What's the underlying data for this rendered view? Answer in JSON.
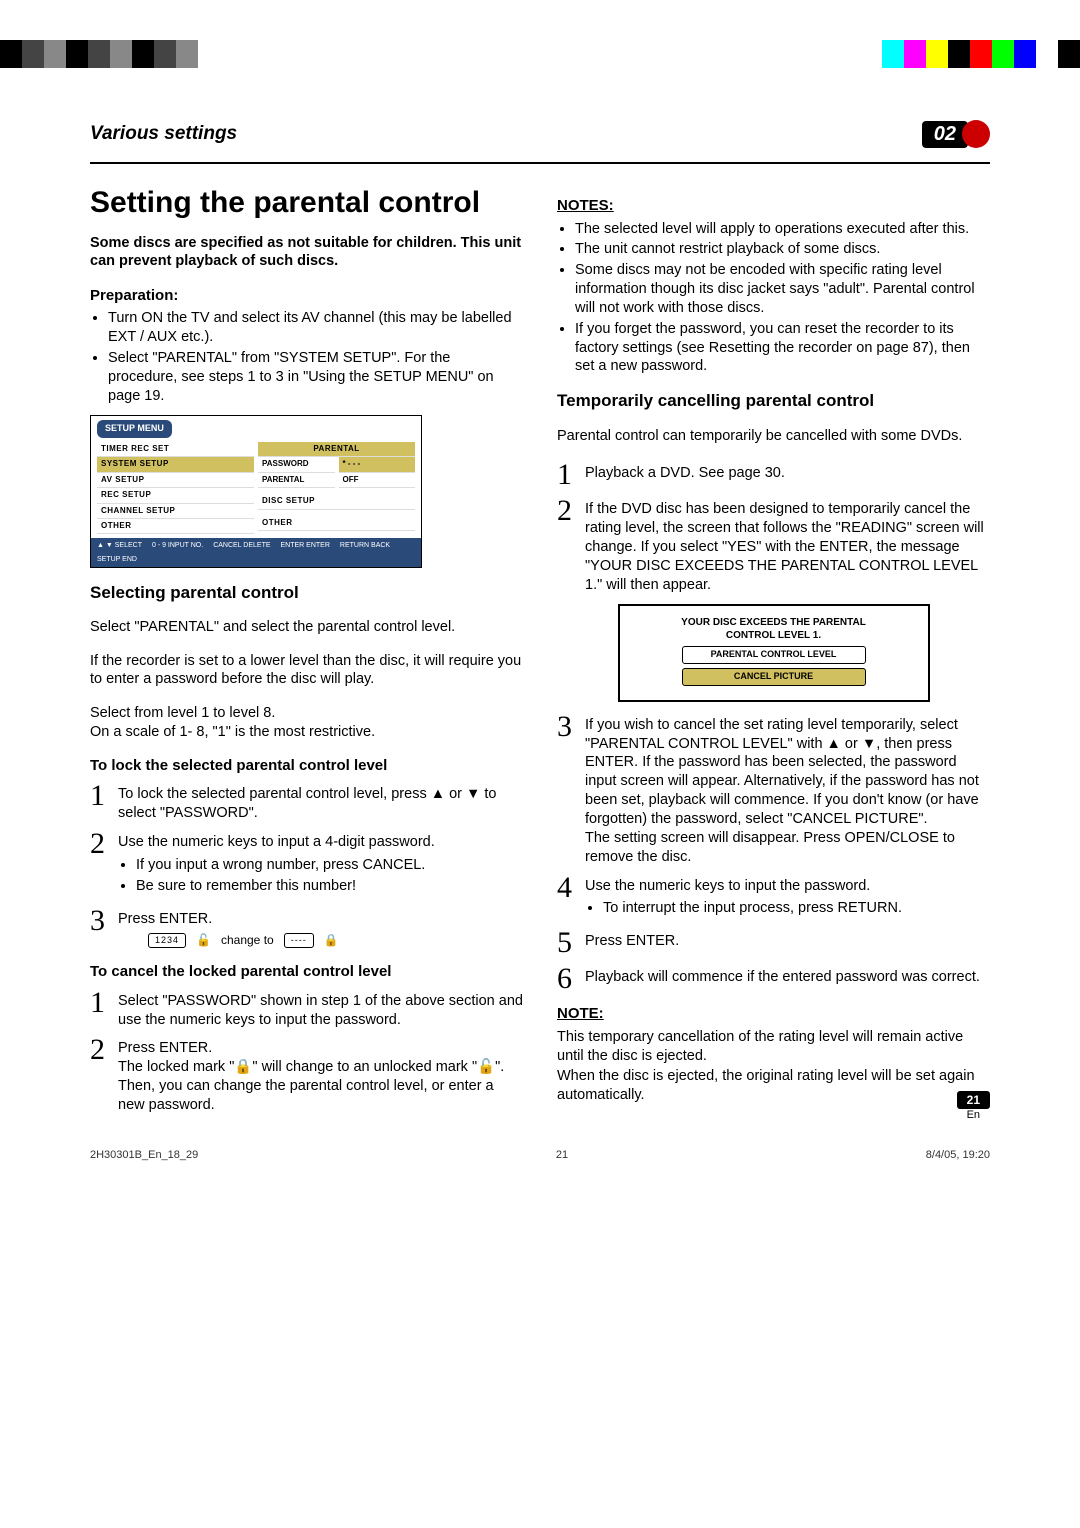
{
  "header": {
    "title": "Various settings",
    "chapter": "02"
  },
  "main_title": "Setting the parental control",
  "intro": "Some discs are specified as not suitable for children. This unit can prevent playback of such discs.",
  "preparation": {
    "heading": "Preparation:",
    "items": [
      "Turn ON the TV and select its AV channel (this may be labelled EXT / AUX etc.).",
      "Select \"PARENTAL\" from \"SYSTEM SETUP\". For the procedure, see steps 1 to 3 in \"Using the SETUP MENU\" on page 19."
    ]
  },
  "setup_menu": {
    "title": "SETUP MENU",
    "left": [
      "TIMER REC SET",
      "SYSTEM SETUP",
      "AV SETUP",
      "REC SETUP",
      "CHANNEL SETUP",
      "OTHER"
    ],
    "right_top_hl": "PARENTAL",
    "right_rows": [
      {
        "l": "PASSWORD",
        "r": "* - - -"
      },
      {
        "l": "PARENTAL",
        "r": "OFF"
      }
    ],
    "right_groups": [
      "DISC SETUP",
      "OTHER"
    ],
    "bottom": [
      "▲ ▼  SELECT",
      "0 - 9  INPUT NO.",
      "CANCEL  DELETE",
      "ENTER  ENTER",
      "RETURN  BACK",
      "SETUP  END"
    ]
  },
  "selecting": {
    "heading": "Selecting parental control",
    "p1": "Select \"PARENTAL\" and select the parental control level.",
    "p2": "If the recorder is set to a lower level than the disc, it will require you to enter a password before the disc will play.",
    "p3": "Select from level 1 to level 8.",
    "p4": "On a scale of 1- 8, \"1\" is the most restrictive.",
    "lock": {
      "heading": "To lock the selected parental control level",
      "s1": "To lock the selected parental control level, press ▲ or ▼ to select \"PASSWORD\".",
      "s2": "Use the numeric keys to input a 4-digit password.",
      "s2b1": "If you input a wrong number, press CANCEL.",
      "s2b2": "Be sure to remember this number!",
      "s3": "Press ENTER.",
      "diag_a": "1234",
      "diag_txt": "change to",
      "diag_b": "----"
    },
    "cancel": {
      "heading": "To cancel the locked parental control level",
      "s1": "Select \"PASSWORD\" shown in step 1 of the above section and use the numeric keys to input the password.",
      "s2a": "Press ENTER.",
      "s2b": "The locked mark \"🔒\" will change to an unlocked mark \"🔓\".",
      "s2c": "Then, you can change the parental control level, or enter a new password."
    }
  },
  "notes": {
    "heading": "NOTES:",
    "items": [
      "The selected level will apply to operations executed after this.",
      "The unit cannot restrict playback of some discs.",
      "Some discs may not be encoded with specific rating level information though its disc jacket says \"adult\". Parental control will not work with those discs.",
      "If you forget the password, you can reset the recorder to its factory settings (see Resetting the recorder on page 87), then set a new password."
    ]
  },
  "temp": {
    "heading": "Temporarily cancelling parental control",
    "intro": "Parental control can temporarily be cancelled with some DVDs.",
    "s1": "Playback a DVD. See page 30.",
    "s2": "If the DVD disc has been designed to temporarily cancel the rating level, the screen that follows the \"READING\" screen will change. If you select \"YES\" with the ENTER, the message \"YOUR DISC EXCEEDS THE PARENTAL CONTROL LEVEL 1.\" will then appear.",
    "dialog": {
      "line1": "YOUR DISC EXCEEDS THE PARENTAL",
      "line2": "CONTROL LEVEL 1.",
      "opt1": "PARENTAL CONTROL LEVEL",
      "opt2": "CANCEL PICTURE"
    },
    "s3a": "If you wish to cancel the set rating level temporarily, select \"PARENTAL CONTROL LEVEL\" with ▲ or ▼, then press ENTER. If the password has been selected, the password input screen will appear. Alternatively, if the password has not been set, playback will commence. If you don't know (or have forgotten) the password, select \"CANCEL PICTURE\".",
    "s3b": "The setting screen will disappear. Press OPEN/CLOSE to remove the disc.",
    "s4a": "Use the numeric keys to input the password.",
    "s4b": "To interrupt the input process, press RETURN.",
    "s5": "Press ENTER.",
    "s6": "Playback will commence if the entered password was correct.",
    "note_heading": "NOTE:",
    "note1": "This temporary cancellation of the rating level will remain active until the disc is ejected.",
    "note2": "When the disc is ejected, the original rating level will be set again automatically."
  },
  "page": {
    "num": "21",
    "lang": "En"
  },
  "footer": {
    "left": "2H30301B_En_18_29",
    "center": "21",
    "right": "8/4/05, 19:20"
  }
}
